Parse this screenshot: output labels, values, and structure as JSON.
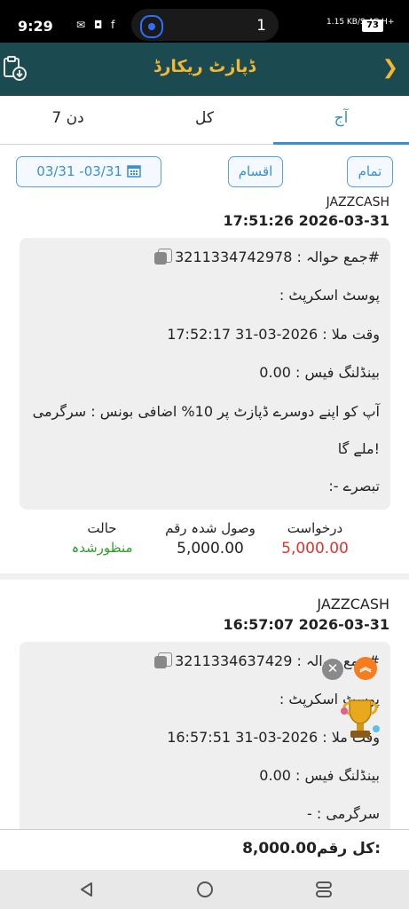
{
  "status_bar": {
    "time": "9:29",
    "notif_icons": "✉ ◘ f",
    "pill_count": "1",
    "net_speed": "1.15 KB/S",
    "signal": "4G H+",
    "battery": "73"
  },
  "header": {
    "title": "ڈپازٹ ریکارڈ",
    "back_icon": "chevron-right-icon",
    "left_icon": "clipboard-download-icon"
  },
  "tabs": [
    {
      "label": "آج",
      "active": true
    },
    {
      "label": "کل",
      "active": false
    },
    {
      "label": "7 دن",
      "active": false
    }
  ],
  "filters": {
    "all": "تمام",
    "types": "اقسام",
    "date_range": "03/31 -03/31"
  },
  "records": [
    {
      "method": "JAZZCASH",
      "datetime": "17:51:26 2026-03-31",
      "ref_label": "جمع حوالہ#",
      "ref_value": "3211334742978",
      "postscript_label": "پوسٹ اسکرپٹ",
      "time_label": "وقت ملا",
      "time_value": "17:52:17 31-03-2026",
      "fee_label": "بینڈلنگ فیس",
      "fee_value": "0.00",
      "activity_label": "سرگرمی",
      "activity_value": "آپ کو اپنے دوسرے ڈپازٹ پر 10% اضافی بونس",
      "activity_value_2": "ملے گا!",
      "comment_label": "تبصرے",
      "request_label": "درخواست",
      "request_value": "5,000.00",
      "received_label": "وصول شدہ رقم",
      "received_value": "5,000.00",
      "status_label": "حالت",
      "status_value": "منظورشدہ"
    },
    {
      "method": "JAZZCASH",
      "datetime": "16:57:07 2026-03-31",
      "ref_label": "جمع حوالہ#",
      "ref_value": "3211334637429",
      "postscript_label": "پوسٹ اسکرپٹ",
      "time_label": "وقت ملا",
      "time_value": "16:57:51 31-03-2026",
      "fee_label": "بینڈلنگ فیس",
      "fee_value": "0.00",
      "activity_label": "سرگرمی",
      "activity_value": "-"
    }
  ],
  "footer": {
    "total_label": "کل رقم:",
    "total_value": "8,000.00"
  },
  "colors": {
    "header_bg": "#1b4a50",
    "accent": "#f5b82e",
    "tab_active": "#3a8fd1",
    "request_red": "#e0332e",
    "status_green": "#2e9e2e"
  }
}
